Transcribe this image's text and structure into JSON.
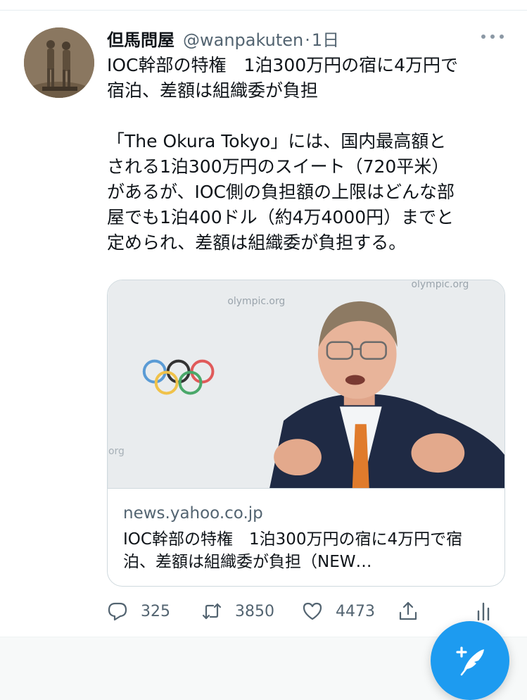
{
  "tweet": {
    "display_name": "但馬問屋",
    "handle": "@wanpakuten",
    "separator": "·",
    "time": "1日",
    "text": "IOC幹部の特権　1泊300万円の宿に4万円で\n宿泊、差額は組織委が負担\n\n「The Okura Tokyo」には、国内最高額と\nされる1泊300万円のスイート（720平米）\nがあるが、IOC側の負担額の上限はどんな部\n屋でも1泊400ドル（約4万4000円）までと\n定められ、差額は組織委が負担する。",
    "card": {
      "image_watermark": "olympic.org",
      "image_watermark_2": "olympic.org",
      "image_watermark_3": "org",
      "domain": "news.yahoo.co.jp",
      "title": "IOC幹部の特権　1泊300万円の宿に4万円で宿泊、差額は組織委が負担（NEW…"
    },
    "actions": {
      "reply_count": "325",
      "retweet_count": "3850",
      "like_count": "4473"
    }
  },
  "icons": {
    "more": "more-horizontal-icon",
    "reply": "speech-bubble-icon",
    "retweet": "retweet-arrows-icon",
    "like": "heart-icon",
    "share": "share-upload-icon",
    "stats": "bar-chart-icon",
    "compose": "compose-feather-icon"
  },
  "colors": {
    "accent": "#1d9bf0",
    "secondary_text": "#536471",
    "primary_text": "#0f1419",
    "border": "#cfd9de"
  }
}
